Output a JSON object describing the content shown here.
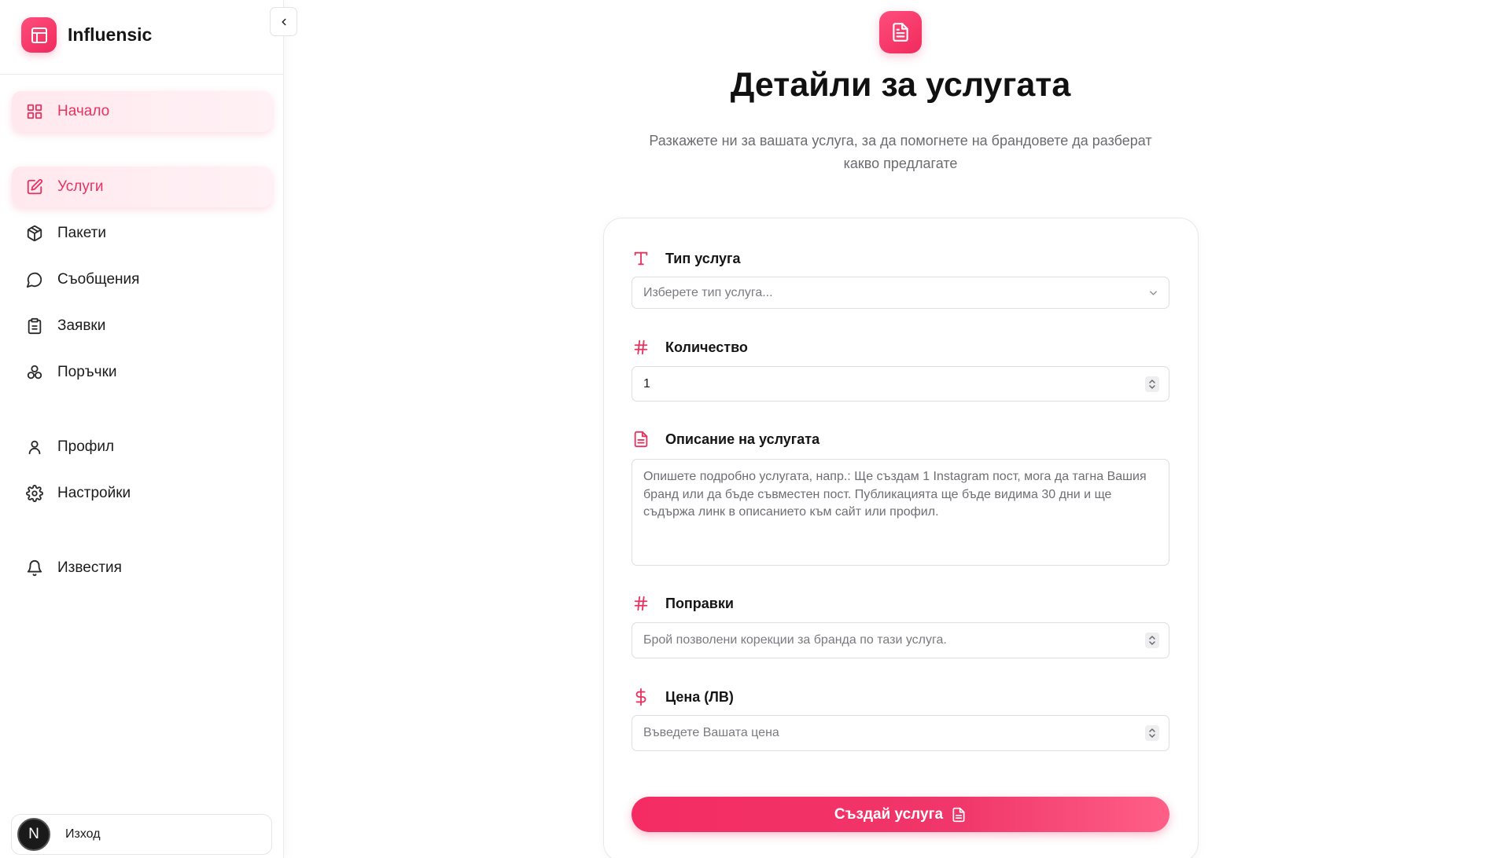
{
  "brand": {
    "name": "Influensic",
    "logo_icon": "layout-icon",
    "accent": "#ef2b5c"
  },
  "sidebar": {
    "collapse_icon": "chevron-left-icon",
    "items": [
      {
        "label": "Начало",
        "icon": "grid-icon",
        "active": true
      },
      {
        "label": "Услуги",
        "icon": "edit-icon",
        "active": true
      },
      {
        "label": "Пакети",
        "icon": "package-icon",
        "active": false
      },
      {
        "label": "Съобщения",
        "icon": "message-icon",
        "active": false
      },
      {
        "label": "Заявки",
        "icon": "clipboard-icon",
        "active": false
      },
      {
        "label": "Поръчки",
        "icon": "boxes-icon",
        "active": false
      },
      {
        "label": "Профил",
        "icon": "user-icon",
        "active": false
      },
      {
        "label": "Настройки",
        "icon": "gear-icon",
        "active": false
      },
      {
        "label": "Известия",
        "icon": "bell-icon",
        "active": false
      }
    ],
    "logout": {
      "avatar_letter": "N",
      "label": "Изход"
    }
  },
  "main": {
    "header_icon": "file-text-icon",
    "title": "Детайли за услугата",
    "subtitle": "Разкажете ни за вашата услуга, за да помогнете на брандовете да разберат какво предлагате",
    "form": {
      "service_type": {
        "label": "Тип услуга",
        "icon": "type-icon",
        "placeholder": "Изберете тип услуга..."
      },
      "quantity": {
        "label": "Количество",
        "icon": "hash-icon",
        "value": "1"
      },
      "description": {
        "label": "Описание на услугата",
        "icon": "file-text-icon",
        "placeholder": "Опишете подробно услугата, напр.: Ще създам 1 Instagram пост, мога да тагна Вашия бранд или да бъде съвместен пост. Публикацията ще бъде видима 30 дни и ще съдържа линк в описанието към сайт или профил."
      },
      "revisions": {
        "label": "Поправки",
        "icon": "hash-icon",
        "placeholder": "Брой позволени корекции за бранда по тази услуга."
      },
      "price": {
        "label": "Цена (ЛВ)",
        "icon": "dollar-icon",
        "placeholder": "Въведете Вашата цена"
      },
      "submit_label": "Създай услуга",
      "submit_icon": "file-text-icon"
    }
  }
}
